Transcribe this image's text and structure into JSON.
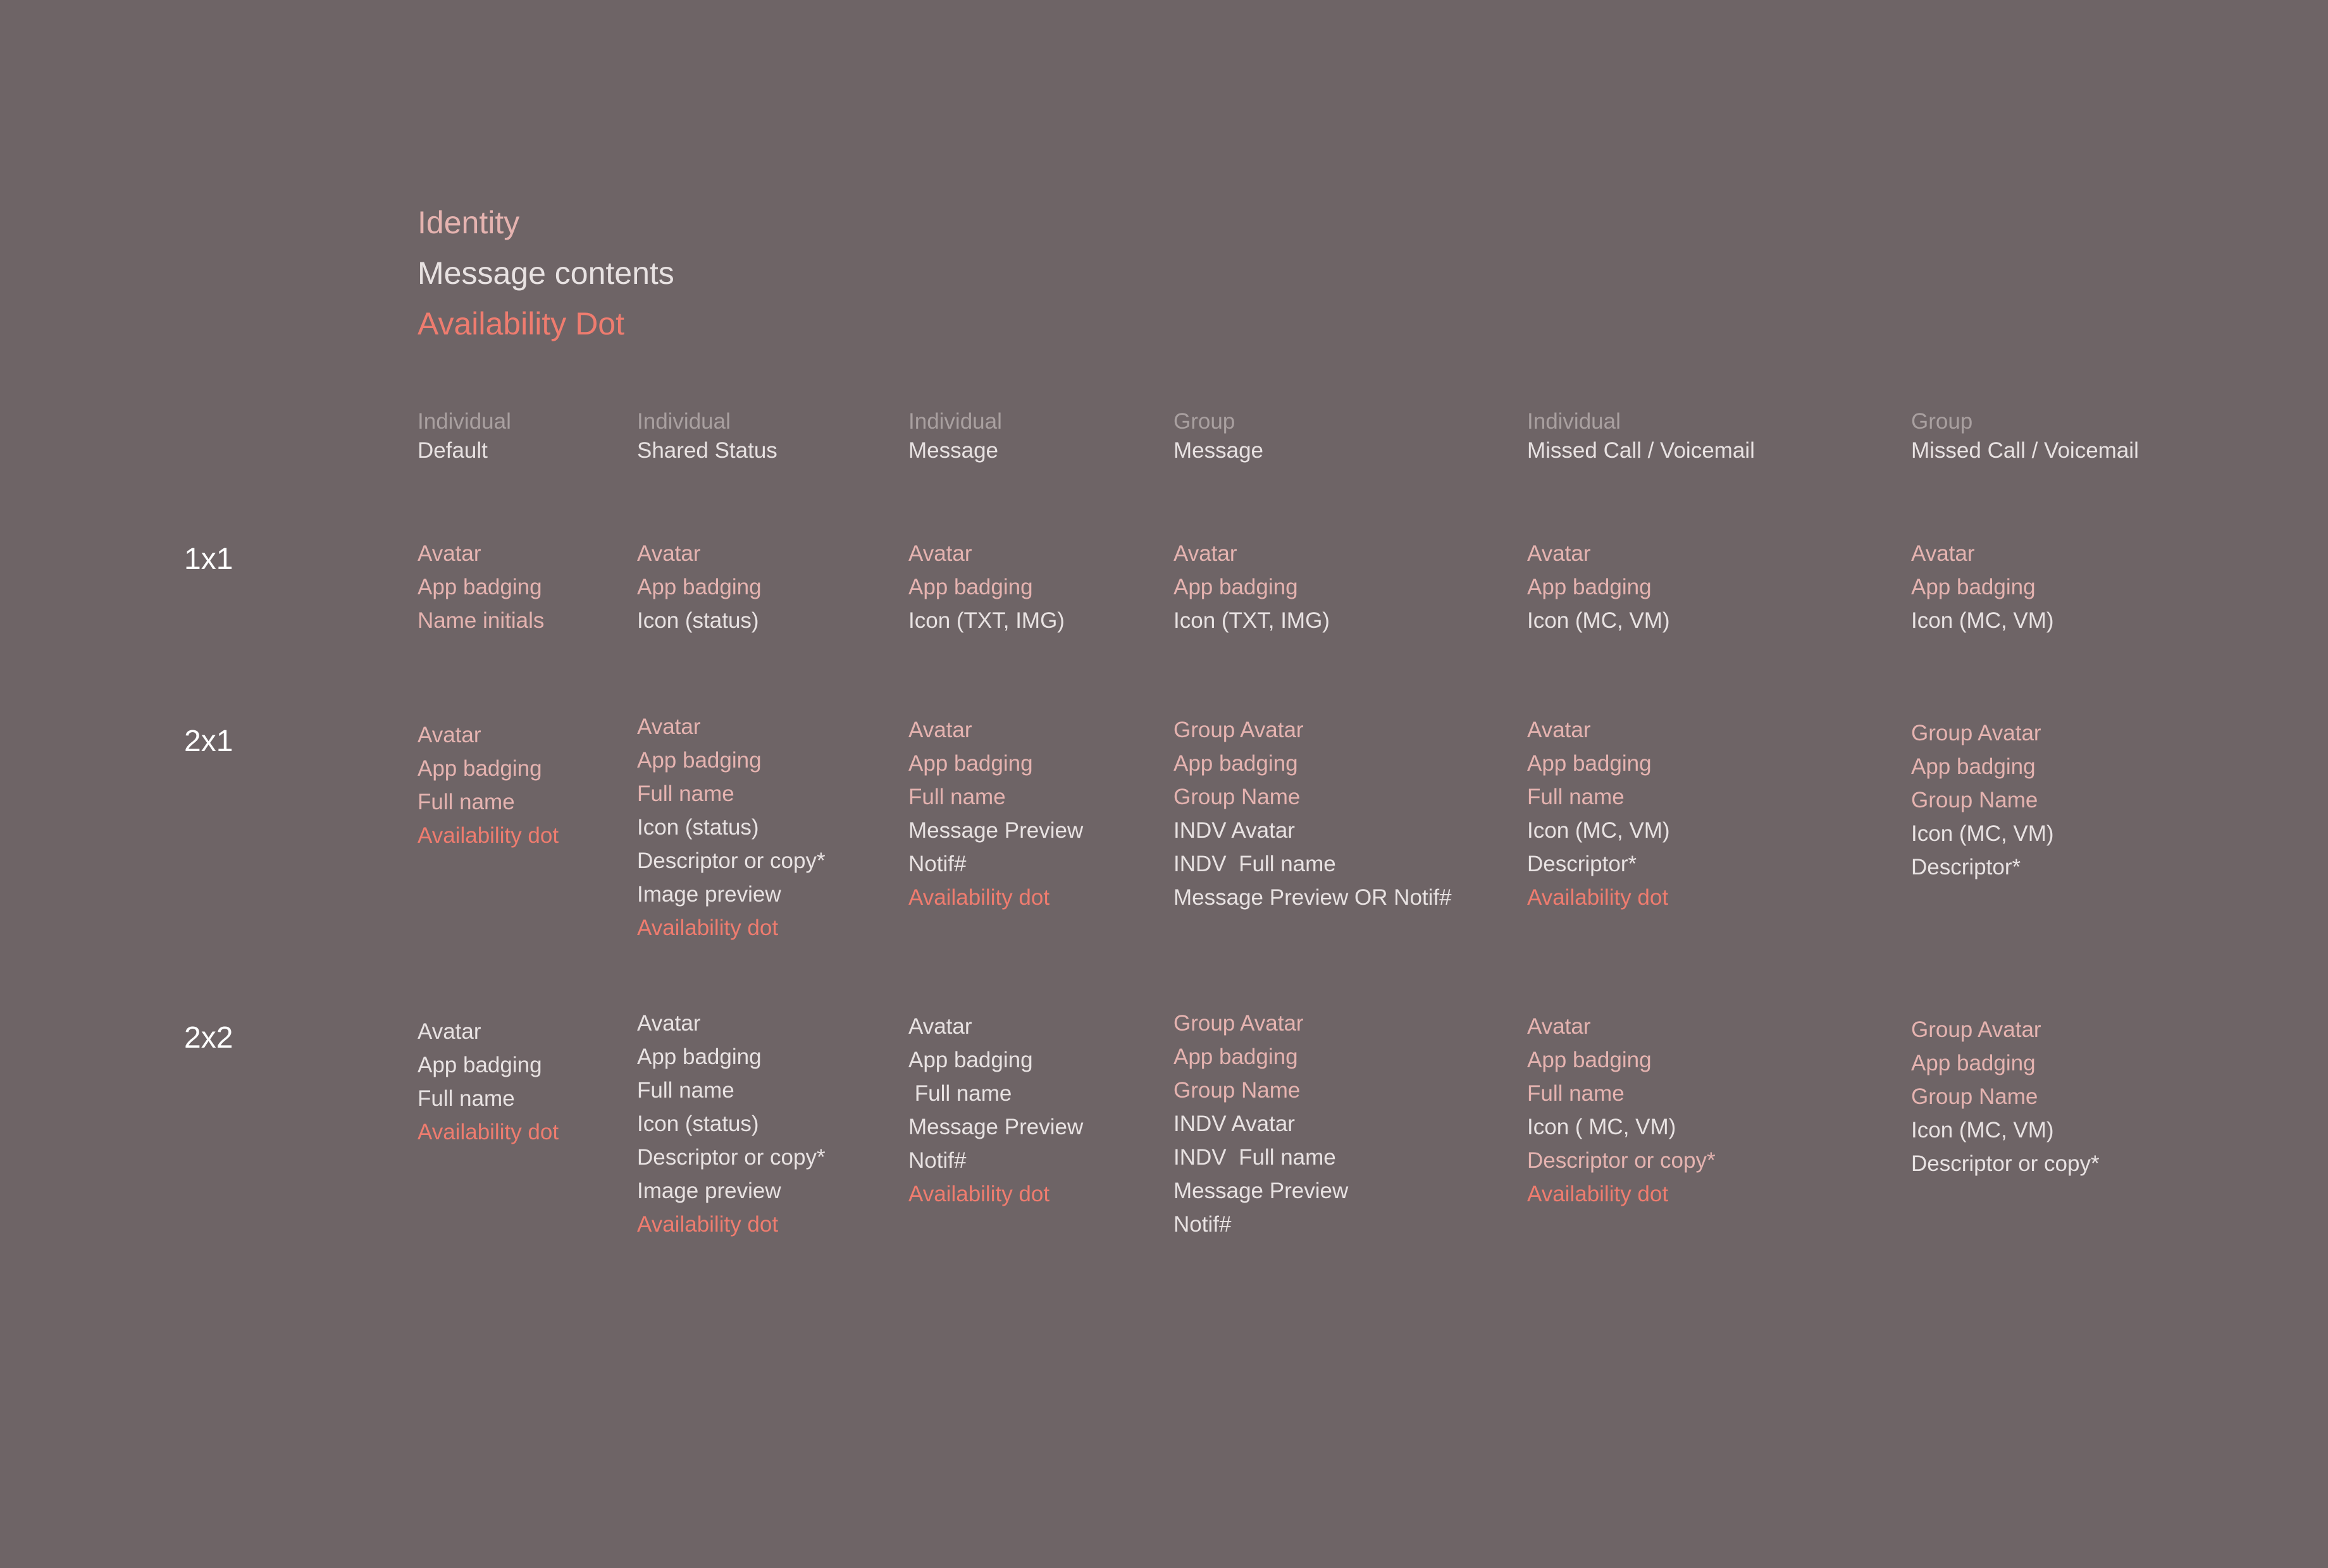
{
  "colors": {
    "background": "#6e6466",
    "identity": "#e5b3b0",
    "message": "#e8e2e2",
    "dot": "#ef7c6f"
  },
  "legend": [
    {
      "text": "Identity",
      "kind": "identity"
    },
    {
      "text": "Message contents",
      "kind": "message"
    },
    {
      "text": "Availability Dot",
      "kind": "dot"
    }
  ],
  "columns": [
    {
      "type": "Individual",
      "name": "Default"
    },
    {
      "type": "Individual",
      "name": "Shared Status"
    },
    {
      "type": "Individual",
      "name": "Message"
    },
    {
      "type": "Group",
      "name": "Message"
    },
    {
      "type": "Individual",
      "name": "Missed Call / Voicemail"
    },
    {
      "type": "Group",
      "name": "Missed Call / Voicemail"
    }
  ],
  "rows": [
    {
      "label": "1x1",
      "cells": [
        [
          {
            "text": "Avatar",
            "kind": "identity"
          },
          {
            "text": "App badging",
            "kind": "identity"
          },
          {
            "text": "Name initials",
            "kind": "identity"
          }
        ],
        [
          {
            "text": "Avatar",
            "kind": "identity"
          },
          {
            "text": "App badging",
            "kind": "identity"
          },
          {
            "text": "Icon (status)",
            "kind": "message"
          }
        ],
        [
          {
            "text": "Avatar",
            "kind": "identity"
          },
          {
            "text": "App badging",
            "kind": "identity"
          },
          {
            "text": "Icon (TXT, IMG)",
            "kind": "message"
          }
        ],
        [
          {
            "text": "Avatar",
            "kind": "identity"
          },
          {
            "text": "App badging",
            "kind": "identity"
          },
          {
            "text": "Icon (TXT, IMG)",
            "kind": "message"
          }
        ],
        [
          {
            "text": "Avatar",
            "kind": "identity"
          },
          {
            "text": "App badging",
            "kind": "identity"
          },
          {
            "text": "Icon (MC, VM)",
            "kind": "message"
          }
        ],
        [
          {
            "text": "Avatar",
            "kind": "identity"
          },
          {
            "text": "App badging",
            "kind": "identity"
          },
          {
            "text": "Icon (MC, VM)",
            "kind": "message"
          }
        ]
      ]
    },
    {
      "label": "2x1",
      "cells": [
        [
          {
            "text": "Avatar",
            "kind": "identity"
          },
          {
            "text": "App badging",
            "kind": "identity"
          },
          {
            "text": "Full name",
            "kind": "identity"
          },
          {
            "text": "Availability dot",
            "kind": "dot"
          }
        ],
        [
          {
            "text": "Avatar",
            "kind": "identity"
          },
          {
            "text": "App badging",
            "kind": "identity"
          },
          {
            "text": "Full name",
            "kind": "identity"
          },
          {
            "text": "Icon (status)",
            "kind": "message"
          },
          {
            "text": "Descriptor or copy*",
            "kind": "message"
          },
          {
            "text": "Image preview",
            "kind": "message"
          },
          {
            "text": "Availability dot",
            "kind": "dot"
          }
        ],
        [
          {
            "text": "Avatar",
            "kind": "identity"
          },
          {
            "text": "App badging",
            "kind": "identity"
          },
          {
            "text": "Full name",
            "kind": "identity"
          },
          {
            "text": "Message Preview",
            "kind": "message"
          },
          {
            "text": "Notif#",
            "kind": "message"
          },
          {
            "text": "Availability dot",
            "kind": "dot"
          }
        ],
        [
          {
            "text": "Group Avatar",
            "kind": "identity"
          },
          {
            "text": "App badging",
            "kind": "identity"
          },
          {
            "text": "Group Name",
            "kind": "identity"
          },
          {
            "text": "INDV Avatar",
            "kind": "message"
          },
          {
            "text": "INDV  Full name",
            "kind": "message"
          },
          {
            "text": "Message Preview OR Notif#",
            "kind": "message"
          }
        ],
        [
          {
            "text": "Avatar",
            "kind": "identity"
          },
          {
            "text": "App badging",
            "kind": "identity"
          },
          {
            "text": "Full name",
            "kind": "identity"
          },
          {
            "text": "Icon (MC, VM)",
            "kind": "message"
          },
          {
            "text": "Descriptor*",
            "kind": "message"
          },
          {
            "text": "Availability dot",
            "kind": "dot"
          }
        ],
        [
          {
            "text": "Group Avatar",
            "kind": "identity"
          },
          {
            "text": "App badging",
            "kind": "identity"
          },
          {
            "text": "Group Name",
            "kind": "identity"
          },
          {
            "text": "Icon (MC, VM)",
            "kind": "message"
          },
          {
            "text": "Descriptor*",
            "kind": "message"
          }
        ]
      ]
    },
    {
      "label": "2x2",
      "cells": [
        [
          {
            "text": "Avatar",
            "kind": "message"
          },
          {
            "text": "App badging",
            "kind": "message"
          },
          {
            "text": "Full name",
            "kind": "message"
          },
          {
            "text": "Availability dot",
            "kind": "dot"
          }
        ],
        [
          {
            "text": "Avatar",
            "kind": "message"
          },
          {
            "text": "App badging",
            "kind": "message"
          },
          {
            "text": "Full name",
            "kind": "message"
          },
          {
            "text": "Icon (status)",
            "kind": "message"
          },
          {
            "text": "Descriptor or copy*",
            "kind": "message"
          },
          {
            "text": "Image preview",
            "kind": "message"
          },
          {
            "text": "Availability dot",
            "kind": "dot"
          }
        ],
        [
          {
            "text": "Avatar",
            "kind": "message"
          },
          {
            "text": "App badging",
            "kind": "message"
          },
          {
            "text": " Full name",
            "kind": "message"
          },
          {
            "text": "Message Preview",
            "kind": "message"
          },
          {
            "text": "Notif#",
            "kind": "message"
          },
          {
            "text": "Availability dot",
            "kind": "dot"
          }
        ],
        [
          {
            "text": "Group Avatar",
            "kind": "identity"
          },
          {
            "text": "App badging",
            "kind": "identity"
          },
          {
            "text": "Group Name",
            "kind": "identity"
          },
          {
            "text": "INDV Avatar",
            "kind": "message"
          },
          {
            "text": "INDV  Full name",
            "kind": "message"
          },
          {
            "text": "Message Preview",
            "kind": "message"
          },
          {
            "text": "Notif#",
            "kind": "message"
          }
        ],
        [
          {
            "text": "Avatar",
            "kind": "identity"
          },
          {
            "text": "App badging",
            "kind": "identity"
          },
          {
            "text": "Full name",
            "kind": "identity"
          },
          {
            "text": "Icon ( MC, VM)",
            "kind": "message"
          },
          {
            "text": "Descriptor or copy*",
            "kind": "identity"
          },
          {
            "text": "Availability dot",
            "kind": "dot"
          }
        ],
        [
          {
            "text": "Group Avatar",
            "kind": "identity"
          },
          {
            "text": "App badging",
            "kind": "identity"
          },
          {
            "text": "Group Name",
            "kind": "identity"
          },
          {
            "text": "Icon (MC, VM)",
            "kind": "message"
          },
          {
            "text": "Descriptor or copy*",
            "kind": "message"
          }
        ]
      ]
    }
  ]
}
